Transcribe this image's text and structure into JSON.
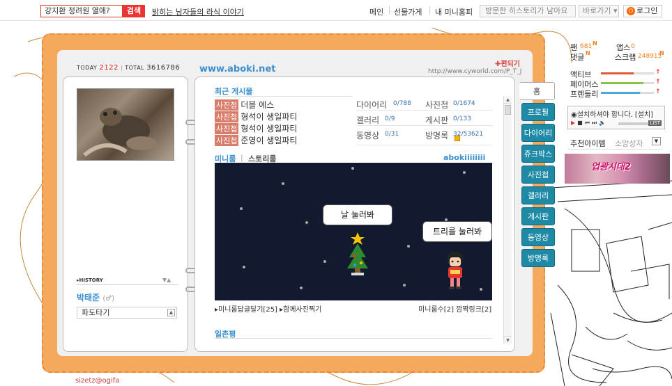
{
  "topbar": {
    "search_placeholder": "강지환 정려원 열애?",
    "search_button": "검색",
    "headline": "밝히는 남자들의 라식 이야기",
    "nav": [
      "메인",
      "선물가게",
      "내 미니홈피"
    ],
    "history_dropdown": "방문한 히스토리가 남아요",
    "back_dropdown": "바로가기",
    "login": "로그인"
  },
  "header": {
    "today_label": "TODAY",
    "today_count": "2122",
    "total_label": "TOTAL",
    "total_count": "3616786",
    "site_title": "www.aboki.net",
    "site_url": "http://www.cyworld.com/P_T_J",
    "edit_link": "편되기"
  },
  "profile": {
    "history_label": "HISTORY",
    "name": "박태준",
    "gender": "(♂)",
    "mood": "파도타기"
  },
  "recent": {
    "title": "최근 게시물",
    "items": [
      {
        "tag": "사진첩",
        "text": "더블 에스"
      },
      {
        "tag": "사진첩",
        "text": "형석이 생일파티"
      },
      {
        "tag": "사진첩",
        "text": "형석이 생일파티"
      },
      {
        "tag": "사진첩",
        "text": "준영이 생일파티"
      }
    ]
  },
  "stats": [
    {
      "label": "다이어리",
      "value": "0/788"
    },
    {
      "label": "사진첩",
      "value": "0/1674"
    },
    {
      "label": "갤러리",
      "value": "0/9"
    },
    {
      "label": "게시판",
      "value": "0/133"
    },
    {
      "label": "동영상",
      "value": "0/31"
    },
    {
      "label": "방명록",
      "value": "32/53621"
    }
  ],
  "miniroom": {
    "tab_miniroom": "미니룸",
    "tab_story": "스토리룸",
    "owner": "abokiiiiiiii",
    "bubble_tree": "날 눌러봐",
    "bubble_avatar": "트리를 눌러봐",
    "bottom_left": "미니룸답글달기[25] ▸함께사진찍기",
    "bottom_right": "미니룸수[2]  깜짝링크[2]"
  },
  "oneline": {
    "title": "일촌평"
  },
  "side_tabs": [
    "홈",
    "프로필",
    "다이어리",
    "쥬크박스",
    "사진첩",
    "갤러리",
    "게시판",
    "동영상",
    "방명록"
  ],
  "sidebar": {
    "fan_label": "팬",
    "fan_count": "681",
    "apps_label": "앱스",
    "apps_count": "0",
    "comment_label": "댓글",
    "scrap_label": "스크랩",
    "scrap_count": "248915",
    "new_mark": "N",
    "meters": [
      {
        "label": "액티브",
        "fill": 0.62,
        "color": "#e05a3a"
      },
      {
        "label": "페이머스",
        "fill": 0.8,
        "color": "#8bc34a"
      },
      {
        "label": "프렌들리",
        "fill": 0.74,
        "color": "#4aa8d8"
      }
    ],
    "player_text": "설치하셔야 합니다. [설치]",
    "player_list": "LIST",
    "rec_item": "추천아이템",
    "wish_item": "소망상자",
    "banner_text": "업광시대2"
  },
  "footer": {
    "signature": "sizetz@ogifa"
  }
}
